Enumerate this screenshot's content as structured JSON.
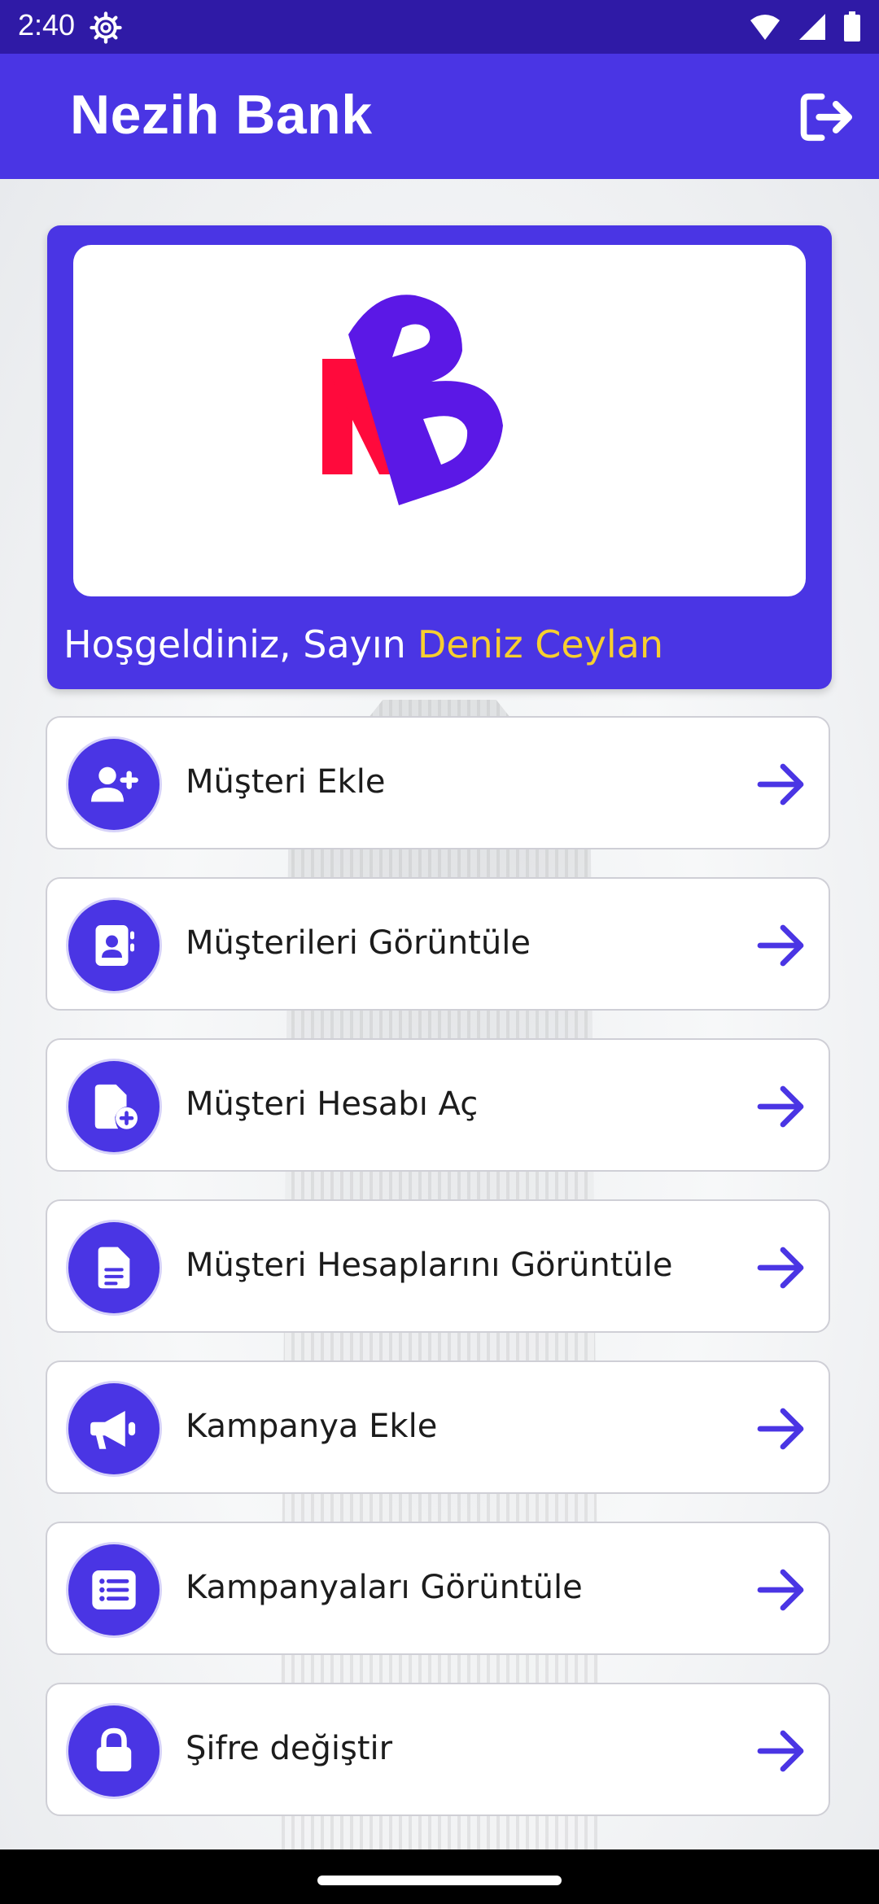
{
  "status_bar": {
    "time": "2:40",
    "icons": [
      "gear-icon",
      "wifi-icon",
      "signal-icon",
      "battery-icon"
    ]
  },
  "app_bar": {
    "title": "Nezih Bank",
    "logout_icon": "logout-icon"
  },
  "hero": {
    "logo": "NB",
    "welcome_text": "Hoşgeldiniz, Sayın",
    "user_name": "Deniz Ceylan"
  },
  "menu": [
    {
      "label": "Müşteri Ekle",
      "icon": "user-plus-icon"
    },
    {
      "label": "Müşterileri Görüntüle",
      "icon": "contact-book-icon"
    },
    {
      "label": "Müşteri Hesabı Aç",
      "icon": "file-plus-icon"
    },
    {
      "label": "Müşteri Hesaplarını Görüntüle",
      "icon": "document-icon"
    },
    {
      "label": "Kampanya Ekle",
      "icon": "megaphone-icon"
    },
    {
      "label": "Kampanyaları Görüntüle",
      "icon": "list-icon"
    },
    {
      "label": "Şifre değiştir",
      "icon": "lock-icon"
    }
  ],
  "colors": {
    "primary": "#4a35e4",
    "status_bar": "#2f1aa6",
    "highlight_name": "#f7cf2e",
    "logo_red": "#ff0a3c",
    "logo_purple": "#5b18e6"
  }
}
